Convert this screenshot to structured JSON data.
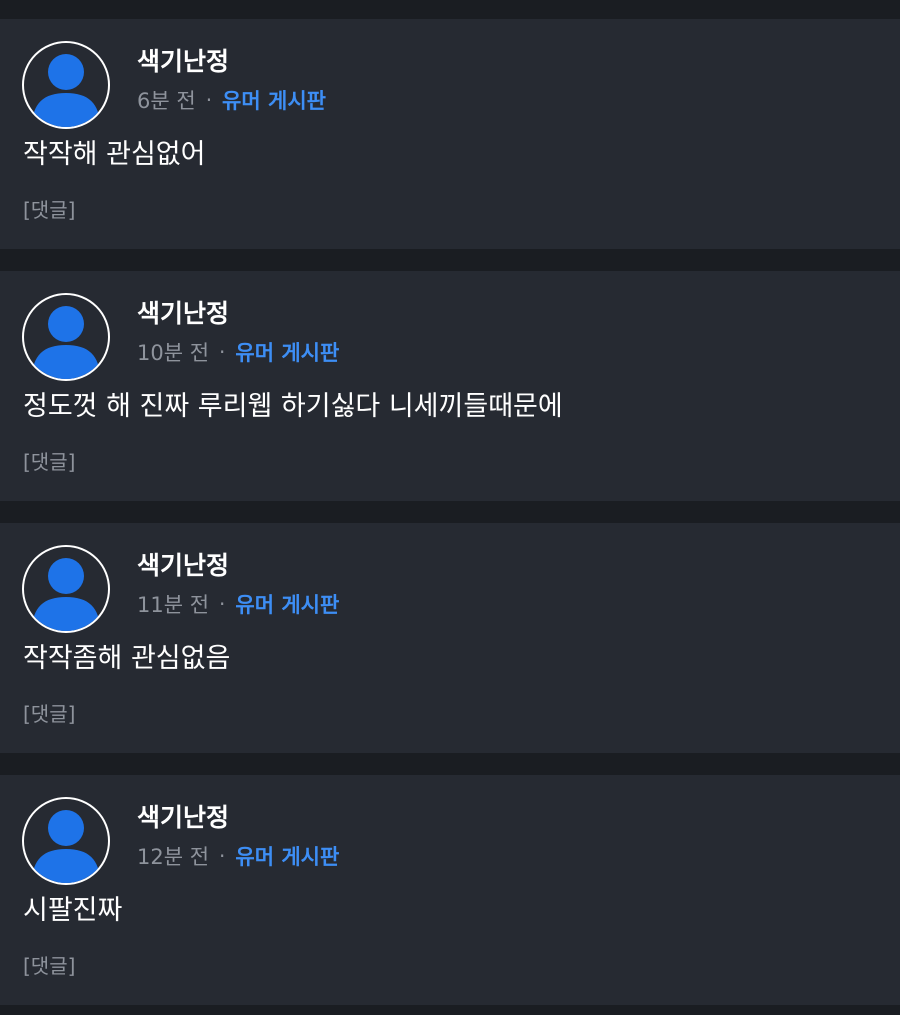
{
  "colors": {
    "page_background": "#1a1d22",
    "card_background": "#262a32",
    "author_text": "#ffffff",
    "meta_text": "#8e939c",
    "board_link": "#3d8ef5",
    "avatar_figure": "#1e73e8",
    "avatar_ring": "#ffffff"
  },
  "separator": "·",
  "posts": [
    {
      "avatar_icon": "default-user-icon",
      "author": "색기난정",
      "time": "6분 전",
      "board": "유머 게시판",
      "content": "작작해 관심없어",
      "comment_label": "[댓글]"
    },
    {
      "avatar_icon": "default-user-icon",
      "author": "색기난정",
      "time": "10분 전",
      "board": "유머 게시판",
      "content": "정도껏 해 진짜 루리웹 하기싫다 니세끼들때문에",
      "comment_label": "[댓글]"
    },
    {
      "avatar_icon": "default-user-icon",
      "author": "색기난정",
      "time": "11분 전",
      "board": "유머 게시판",
      "content": "작작좀해 관심없음",
      "comment_label": "[댓글]"
    },
    {
      "avatar_icon": "default-user-icon",
      "author": "색기난정",
      "time": "12분 전",
      "board": "유머 게시판",
      "content": "시팔진짜",
      "comment_label": "[댓글]"
    }
  ]
}
